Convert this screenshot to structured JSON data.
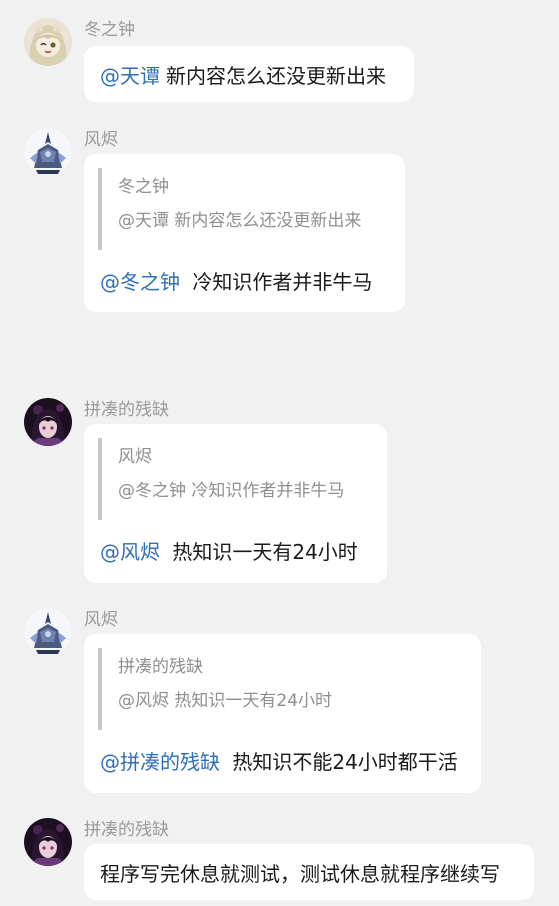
{
  "colors": {
    "background": "#f1f1f1",
    "bubble": "#ffffff",
    "mention": "#2f6eb8",
    "name": "#9a9a9a",
    "quote_bar": "#c8c8c8"
  },
  "messages": [
    {
      "sender": "冬之钟",
      "avatar": "anime-girl-avatar",
      "mention": "@天谭",
      "text": "新内容怎么还没更新出来"
    },
    {
      "sender": "风烬",
      "avatar": "armored-figure-avatar",
      "quote": {
        "author": "冬之钟",
        "text": "@天谭 新内容怎么还没更新出来"
      },
      "mention": "@冬之钟",
      "text": "冷知识作者并非牛马"
    },
    {
      "sender": "拼凑的残缺",
      "avatar": "dark-hair-girl-avatar",
      "quote": {
        "author": "风烬",
        "text": "@冬之钟 冷知识作者并非牛马"
      },
      "mention": "@风烬",
      "text": "热知识一天有24小时"
    },
    {
      "sender": "风烬",
      "avatar": "armored-figure-avatar",
      "quote": {
        "author": "拼凑的残缺",
        "text": "@风烬 热知识一天有24小时"
      },
      "mention": "@拼凑的残缺",
      "text": "热知识不能24小时都干活"
    },
    {
      "sender": "拼凑的残缺",
      "avatar": "dark-hair-girl-avatar",
      "text": "程序写完休息就测试，测试休息就程序继续写"
    }
  ]
}
